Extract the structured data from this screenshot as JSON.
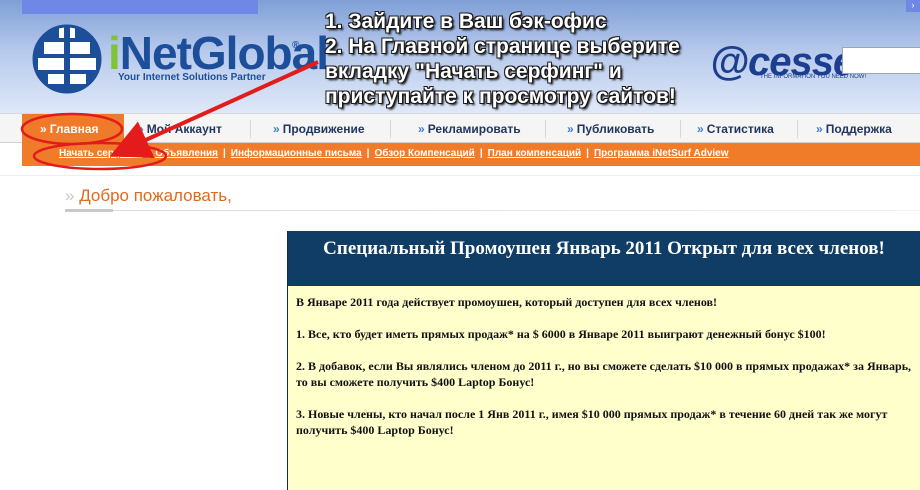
{
  "header": {
    "logo": {
      "i": "i",
      "rest": "NetGlobal",
      "reg": "®",
      "tagline": "Your Internet Solutions Partner"
    },
    "instructions": [
      "1. Зайдите в Ваш бэк-офис",
      "2. На Главной странице выберите",
      "вкладку \"Начать серфинг\" и",
      "приступайте к просмотру сайтов!"
    ],
    "acesse": {
      "name": "@cesse",
      "tagline": "THE INFORMATION YOU NEED NOW!"
    },
    "corner_label": "›"
  },
  "nav": {
    "items": [
      {
        "label": "Главная",
        "active": true
      },
      {
        "label": "Мой Аккаунт"
      },
      {
        "label": "Продвижение"
      },
      {
        "label": "Рекламировать"
      },
      {
        "label": "Публиковать"
      },
      {
        "label": "Статистика"
      },
      {
        "label": "Поддержка"
      }
    ],
    "arrow": "»",
    "subnav": [
      "Начать серфинг!",
      "Объявления",
      "Информационные письма",
      "Обзор Компенсаций",
      "План компенсаций",
      "Программа iNetSurf Adview"
    ],
    "subnav_sep": "|"
  },
  "welcome": {
    "arrow": "»",
    "text": "Добро пожаловать,"
  },
  "promo": {
    "title": "Специальный Промоушен Январь 2011 Открыт для всех членов!",
    "paragraphs": [
      "В Январе 2011 года действует промоушен, который доступен для всех членов!",
      "1. Все, кто будет иметь прямых продаж* на $ 6000 в Январе 2011 выиграют денежный бонус $100!",
      "2. В добавок, если Вы являлись членом до 2011 г., но вы сможете сделать $10 000 в прямых продажах* за Январь, то вы сможете получить $400 Laptop Бонус!",
      "3. Новые члены, кто начал после 1 Янв 2011 г., имея $10 000 прямых продаж* в течение 60 дней так же могут получить $400 Laptop Бонус!"
    ]
  },
  "colors": {
    "orange": "#ef7a2a",
    "navy": "#0f3d66",
    "promo_bg": "#ffffcc",
    "annotation_red": "#e31b1b"
  }
}
